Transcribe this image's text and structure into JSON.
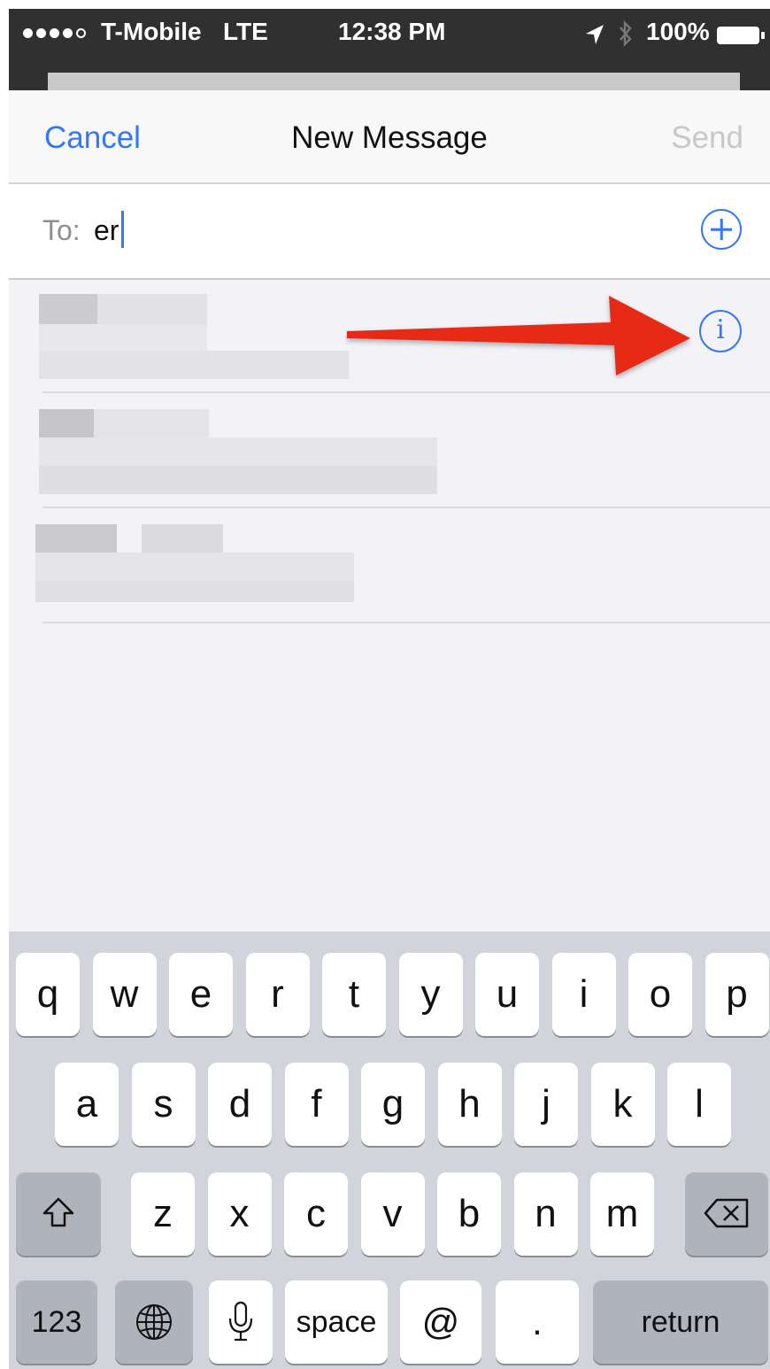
{
  "status_bar": {
    "carrier": "T-Mobile",
    "network": "LTE",
    "time": "12:38 PM",
    "battery": "100%"
  },
  "nav": {
    "cancel_label": "Cancel",
    "title": "New Message",
    "send_label": "Send"
  },
  "to_field": {
    "label": "To:",
    "value": "er"
  },
  "colors": {
    "accent": "#3478f6",
    "arrow": "#e62a16",
    "disabled": "#c7c7cc"
  },
  "keyboard": {
    "row1": [
      "q",
      "w",
      "e",
      "r",
      "t",
      "y",
      "u",
      "i",
      "o",
      "p"
    ],
    "row2": [
      "a",
      "s",
      "d",
      "f",
      "g",
      "h",
      "j",
      "k",
      "l"
    ],
    "row3": [
      "z",
      "x",
      "c",
      "v",
      "b",
      "n",
      "m"
    ],
    "numbers_label": "123",
    "space_label": "space",
    "at_label": "@",
    "period_label": ".",
    "return_label": "return"
  }
}
